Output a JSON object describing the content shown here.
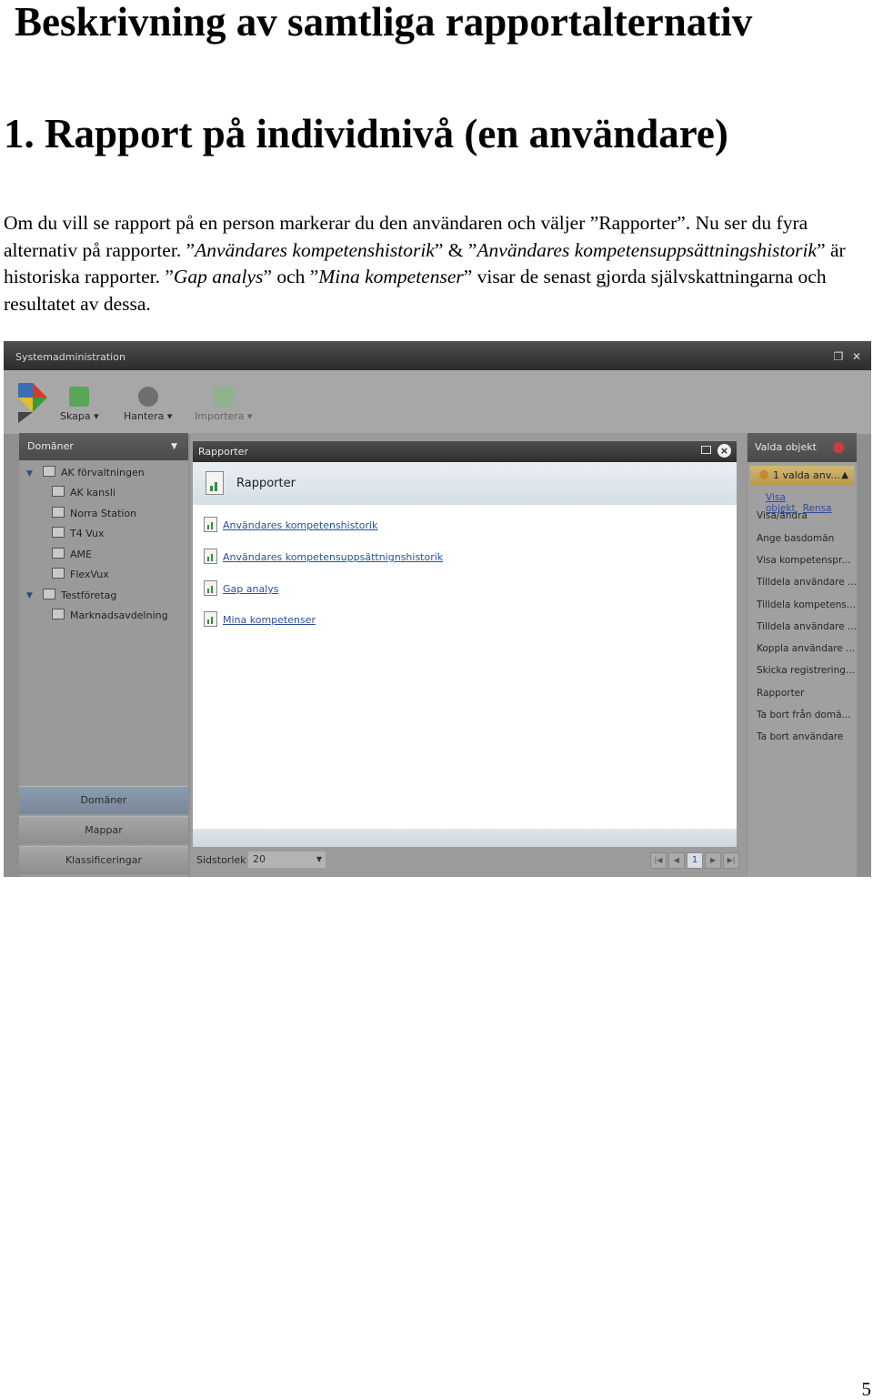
{
  "doc": {
    "title": "Beskrivning av samtliga rapportalternativ",
    "heading": "1. Rapport på individnivå (en användare)",
    "para": {
      "p1": "Om du vill se rapport på en person markerar du den användaren och väljer ”Rapporter”. Nu ser du fyra alternativ på rapporter. ”",
      "i1": "Användares kompetenshistorik",
      "p2": "” & ”",
      "i2": "Användares kompetensuppsättningshistorik",
      "p3": "” är historiska rapporter. ”",
      "i3": "Gap analys",
      "p4": "” och ”",
      "i4": "Mina kompetenser",
      "p5": "” visar de senast gjorda självskattningarna och resultatet av dessa."
    },
    "page_number": "5"
  },
  "app": {
    "window_title": "Systemadministration",
    "toolbar": {
      "skapa": "Skapa",
      "hantera": "Hantera",
      "importera": "Importera"
    },
    "left": {
      "header": "Domäner",
      "tree": [
        "AK förvaltningen",
        "AK kansli",
        "Norra Station",
        "T4 Vux",
        "AME",
        "FlexVux",
        "Testföretag",
        "Marknadsavdelning"
      ],
      "tabs": [
        "Domäner",
        "Mappar",
        "Klassificeringar"
      ]
    },
    "right": {
      "header": "Valda objekt",
      "selected": "1 valda anv...",
      "show_link": "Visa objekt",
      "clear_link": "Rensa",
      "actions": [
        "Visa/ändra",
        "Ange basdomän",
        "Visa kompetenspr...",
        "Tilldela användare ...",
        "Tilldela kompetens...",
        "Tilldela användare ...",
        "Koppla användare ...",
        "Skicka registrering...",
        "Rapporter",
        "Ta bort från domä...",
        "Ta bort användare"
      ]
    },
    "bottom": {
      "page_size_label": "Sidstorlek",
      "page_size": "20",
      "page": "1"
    },
    "dialog": {
      "title": "Rapporter",
      "heading": "Rapporter",
      "reports": [
        "Användares kompetenshistorik",
        "Användares kompetensuppsättnignshistorik",
        "Gap analys",
        "Mina kompetenser"
      ]
    }
  },
  "colors": {
    "link": "#2a4f9a",
    "titlebar": "#3a3a3a",
    "selection": "#c9ad62"
  }
}
